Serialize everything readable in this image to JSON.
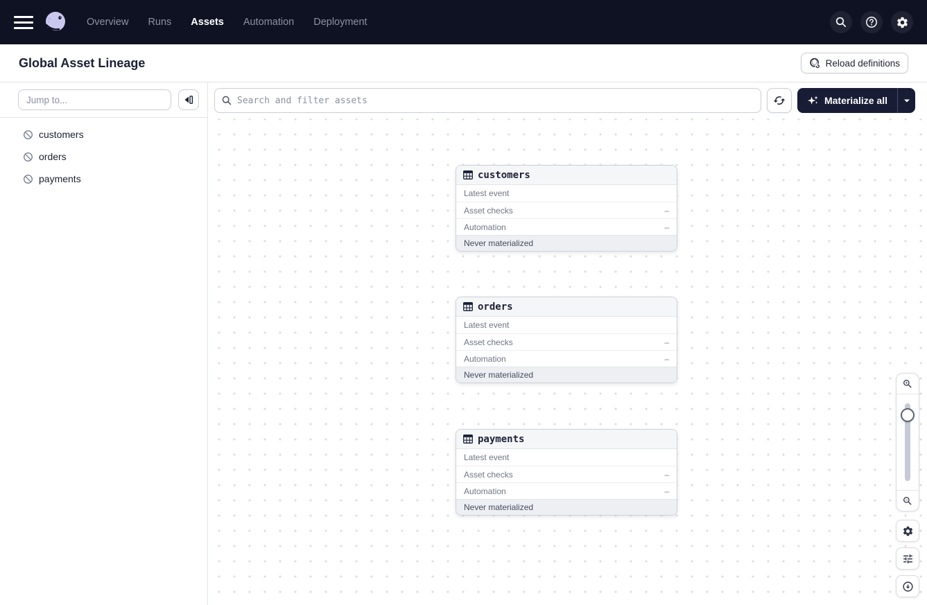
{
  "nav": {
    "items": [
      {
        "label": "Overview"
      },
      {
        "label": "Runs"
      },
      {
        "label": "Assets"
      },
      {
        "label": "Automation"
      },
      {
        "label": "Deployment"
      }
    ],
    "active": "Assets"
  },
  "header": {
    "title": "Global Asset Lineage",
    "reload_label": "Reload definitions"
  },
  "sidebar": {
    "jump_placeholder": "Jump to...",
    "assets": [
      {
        "name": "customers"
      },
      {
        "name": "orders"
      },
      {
        "name": "payments"
      }
    ]
  },
  "toolbar": {
    "search_placeholder": "Search and filter assets",
    "materialize_label": "Materialize all"
  },
  "nodes": [
    {
      "name": "customers",
      "rows": [
        {
          "label": "Latest event",
          "value": ""
        },
        {
          "label": "Asset checks",
          "value": "–"
        },
        {
          "label": "Automation",
          "value": "–"
        }
      ],
      "footer": "Never materialized"
    },
    {
      "name": "orders",
      "rows": [
        {
          "label": "Latest event",
          "value": ""
        },
        {
          "label": "Asset checks",
          "value": "–"
        },
        {
          "label": "Automation",
          "value": "–"
        }
      ],
      "footer": "Never materialized"
    },
    {
      "name": "payments",
      "rows": [
        {
          "label": "Latest event",
          "value": ""
        },
        {
          "label": "Asset checks",
          "value": "–"
        },
        {
          "label": "Automation",
          "value": "–"
        }
      ],
      "footer": "Never materialized"
    }
  ],
  "icons": {
    "hamburger": "menu-icon",
    "logo": "dagster-logo",
    "search": "search-icon",
    "help": "help-icon",
    "gear": "gear-icon",
    "reload": "code-location-reload-icon",
    "collapse": "collapse-panel-icon",
    "asset_status": "slash-circle-icon",
    "refresh_graph": "refresh-icon",
    "sparkle": "sparkle-icon",
    "caret": "chevron-down-icon",
    "table": "table-icon",
    "zoom_in": "zoom-in-icon",
    "zoom_out": "zoom-out-icon",
    "filter": "tune-sliders-icon",
    "recenter": "arrow-down-circle-icon"
  },
  "colors": {
    "nav_bg": "#0f1222",
    "nav_icon_circle": "#1e2233",
    "accent_dark_button": "#181c35",
    "node_header_bg": "#f5f6f8",
    "node_footer_bg": "#edeff3",
    "border": "#c9cdd6",
    "dot_grid": "#dedfe2"
  }
}
